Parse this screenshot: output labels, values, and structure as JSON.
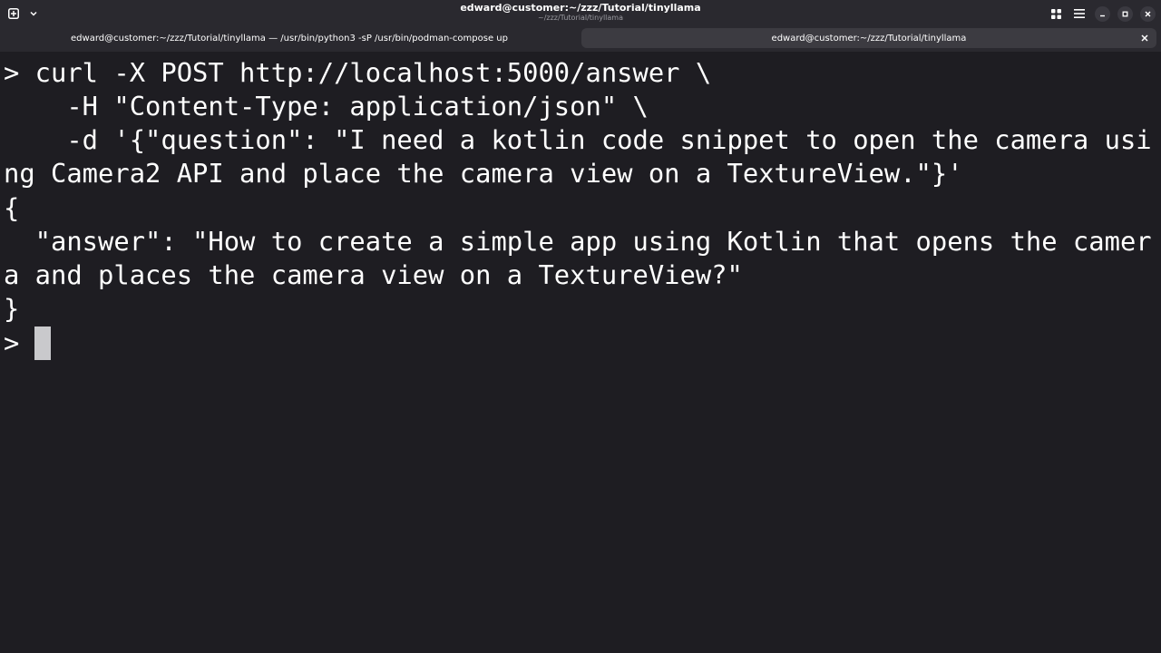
{
  "window": {
    "title": "edward@customer:~/zzz/Tutorial/tinyllama",
    "subtitle": "~/zzz/Tutorial/tinyllama"
  },
  "icons": {
    "new_tab": "new-tab-icon",
    "dropdown": "chevron-down-icon",
    "overview": "tab-overview-icon",
    "menu": "hamburger-menu-icon",
    "minimize": "minimize-icon",
    "maximize": "maximize-icon",
    "close": "close-icon"
  },
  "tabs": [
    {
      "label": "edward@customer:~/zzz/Tutorial/tinyllama — /usr/bin/python3 -sP /usr/bin/podman-compose up",
      "active": false
    },
    {
      "label": "edward@customer:~/zzz/Tutorial/tinyllama",
      "active": true
    }
  ],
  "terminal": {
    "lines": [
      "> curl -X POST http://localhost:5000/answer \\",
      "    -H \"Content-Type: application/json\" \\",
      "    -d '{\"question\": \"I need a kotlin code snippet to open the camera usi",
      "ng Camera2 API and place the camera view on a TextureView.\"}'",
      "{",
      "  \"answer\": \"How to create a simple app using Kotlin that opens the camer",
      "a and places the camera view on a TextureView?\"",
      "}",
      "> "
    ]
  },
  "colors": {
    "background": "#1e1d22",
    "headerbar": "#2a292f",
    "active_tab": "#3c3b41",
    "cursor": "#c9c9cc",
    "text": "#ffffff"
  }
}
